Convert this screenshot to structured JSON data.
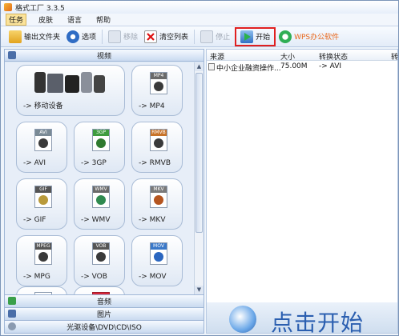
{
  "window": {
    "title": "格式工厂 3.3.5"
  },
  "menu": [
    "任务",
    "皮肤",
    "语言",
    "帮助"
  ],
  "toolbar": {
    "output_folder": "输出文件夹",
    "options": "选项",
    "remove": "移除",
    "clear_list": "清空列表",
    "stop": "停止",
    "start": "开始",
    "wps": "WPS办公软件"
  },
  "categories": {
    "video": "视频",
    "audio": "音频",
    "image": "图片",
    "disc": "光驱设备\\DVD\\CD\\ISO"
  },
  "tiles": [
    {
      "label": "-> 移动设备",
      "tag": ""
    },
    {
      "label": "-> MP4",
      "tag": "MP4"
    },
    {
      "label": "-> AVI",
      "tag": "AVI"
    },
    {
      "label": "-> 3GP",
      "tag": "3GP"
    },
    {
      "label": "-> RMVB",
      "tag": "RMVB"
    },
    {
      "label": "-> GIF",
      "tag": "GIF"
    },
    {
      "label": "-> WMV",
      "tag": "WMV"
    },
    {
      "label": "-> MKV",
      "tag": "MKV"
    },
    {
      "label": "-> MPG",
      "tag": "MPEG"
    },
    {
      "label": "-> VOB",
      "tag": "VOB"
    },
    {
      "label": "-> MOV",
      "tag": "MOV"
    }
  ],
  "table": {
    "headers": [
      "来源",
      "大小",
      "转换状态",
      "转"
    ],
    "rows": [
      {
        "source": "中小企业融资操作...",
        "size": "75.00M",
        "status": "-> AVI"
      }
    ]
  },
  "banner": {
    "text": "点击开始"
  },
  "colors": {
    "accent": "#2b5fb0",
    "start_highlight": "#e02020",
    "wps": "#e8661a"
  }
}
